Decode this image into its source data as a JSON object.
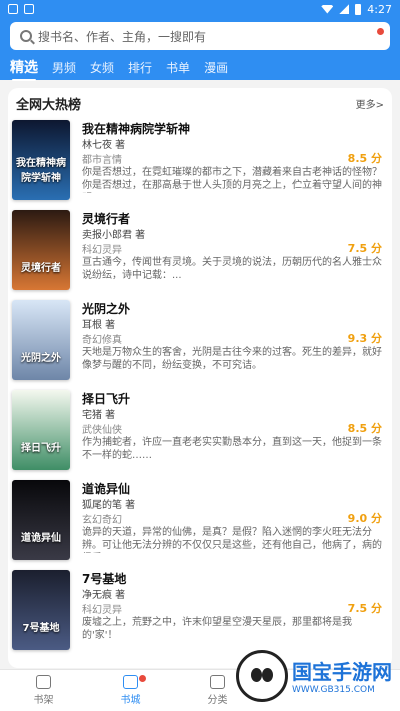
{
  "status_bar": {
    "time": "4:27",
    "left_icons": [
      "shield-icon",
      "notification-icon"
    ]
  },
  "search": {
    "placeholder": "搜书名、作者、主角，一搜即有"
  },
  "tabs": [
    {
      "label": "精选",
      "active": true
    },
    {
      "label": "男频"
    },
    {
      "label": "女频"
    },
    {
      "label": "排行"
    },
    {
      "label": "书单"
    },
    {
      "label": "漫画"
    }
  ],
  "section": {
    "title": "全网大热榜",
    "more": "更多>"
  },
  "books": [
    {
      "title": "我在精神病院学斩神",
      "author": "林七夜 著",
      "genre": "都市言情",
      "score": "8.5 分",
      "cover_color": "#1b2a48",
      "desc": "你是否想过，在霓虹璀璨的都市之下，潜藏着来自古老神话的怪物？你是否想过，在那高悬于世人头顶的月亮之上，伫立着守望人间的神明？"
    },
    {
      "title": "灵境行者",
      "author": "卖报小郎君 著",
      "genre": "科幻灵异",
      "score": "7.5 分",
      "cover_color": "#c45e24",
      "desc": "亘古通今，传闻世有灵境。关于灵境的说法，历朝历代的名人雅士众说纷纭，诗中记载：..."
    },
    {
      "title": "光阴之外",
      "author": "耳根 著",
      "genre": "奇幻修真",
      "score": "9.3 分",
      "cover_color": "#5a6f8c",
      "desc": "天地是万物众生的客舍，光阴是古往今来的过客。死生的差异，就好像梦与醒的不同，纷纭变换，不可究诘。"
    },
    {
      "title": "择日飞升",
      "author": "宅猪 著",
      "genre": "武侠仙侠",
      "score": "8.5 分",
      "cover_color": "#4f8b6a",
      "desc": "作为捕蛇者，许应一直老老实实勤恳本分，直到这一天，他捉到一条不一样的蛇……"
    },
    {
      "title": "道诡异仙",
      "author": "狐尾的笔 著",
      "genre": "玄幻奇幻",
      "score": "9.0 分",
      "cover_color": "#1c1c20",
      "desc": "诡异的天道，异常的仙佛，是真？是假？陷入迷惘的李火旺无法分辨。可让他无法分辨的不仅仅只是这些，还有他自己，他病了，病的很重。"
    },
    {
      "title": "7号基地",
      "author": "净无痕 著",
      "genre": "科幻灵异",
      "score": "7.5 分",
      "cover_color": "#2b3650",
      "desc": "废墟之上，荒野之中，许末仰望星空漫天星辰，那里都将是我的'家'！"
    }
  ],
  "bottom_nav": [
    {
      "label": "书架"
    },
    {
      "label": "书城",
      "active": true
    },
    {
      "label": "分类"
    }
  ],
  "watermark": {
    "text": "国宝手游网",
    "url": "WWW.GB315.COM"
  }
}
